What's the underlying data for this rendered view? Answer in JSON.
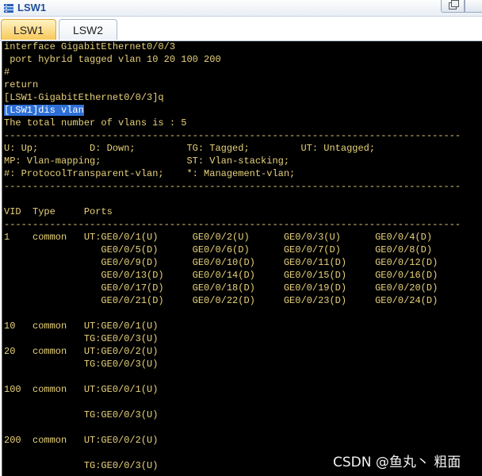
{
  "window": {
    "title": "LSW1",
    "icon": "switch-console-icon"
  },
  "tabs": [
    {
      "label": "LSW1",
      "active": true
    },
    {
      "label": "LSW2",
      "active": false
    }
  ],
  "terminal": {
    "foreground_color": "#e8d27a",
    "background_color": "#000000",
    "selection_color": "#2d6fd6",
    "lines": [
      "interface GigabitEthernet0/0/3",
      " port hybrid tagged vlan 10 20 100 200",
      "#",
      "return",
      "[LSW1-GigabitEthernet0/0/3]q",
      "",
      "The total number of vlans is : 5",
      "--------------------------------------------------------------------------------",
      "U: Up;         D: Down;         TG: Tagged;         UT: Untagged;",
      "MP: Vlan-mapping;               ST: Vlan-stacking;",
      "#: ProtocolTransparent-vlan;    *: Management-vlan;",
      "--------------------------------------------------------------------------------",
      "",
      "VID  Type     Ports",
      "--------------------------------------------------------------------------------",
      "1    common   UT:GE0/0/1(U)      GE0/0/2(U)      GE0/0/3(U)      GE0/0/4(D)",
      "                 GE0/0/5(D)      GE0/0/6(D)      GE0/0/7(D)      GE0/0/8(D)",
      "                 GE0/0/9(D)      GE0/0/10(D)     GE0/0/11(D)     GE0/0/12(D)",
      "                 GE0/0/13(D)     GE0/0/14(D)     GE0/0/15(D)     GE0/0/16(D)",
      "                 GE0/0/17(D)     GE0/0/18(D)     GE0/0/19(D)     GE0/0/20(D)",
      "                 GE0/0/21(D)     GE0/0/22(D)     GE0/0/23(D)     GE0/0/24(D)",
      "",
      "10   common   UT:GE0/0/1(U)",
      "              TG:GE0/0/3(U)",
      "20   common   UT:GE0/0/2(U)",
      "              TG:GE0/0/3(U)",
      "",
      "100  common   UT:GE0/0/1(U)",
      "",
      "              TG:GE0/0/3(U)",
      "",
      "200  common   UT:GE0/0/2(U)",
      "",
      "              TG:GE0/0/3(U)"
    ],
    "highlighted_command": "[LSW1]dis vlan"
  },
  "watermark": "CSDN @鱼丸丶 粗面"
}
